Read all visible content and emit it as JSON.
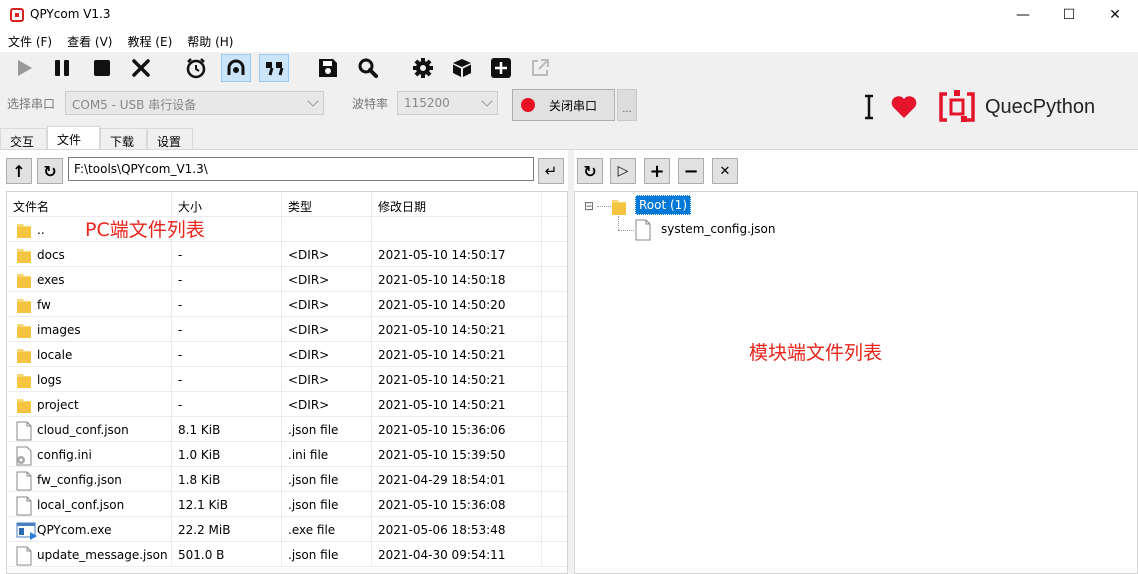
{
  "window": {
    "title": "QPYcom V1.3",
    "minimize_glyph": "—",
    "maximize_glyph": "☐",
    "close_glyph": "✕"
  },
  "menu": [
    "文件 (F)",
    "查看 (V)",
    "教程 (E)",
    "帮助 (H)"
  ],
  "toolbar": {
    "icons": [
      "play-icon",
      "pause-icon",
      "stop-icon",
      "clear-icon",
      "clock-icon",
      "hook-icon",
      "quote-icon",
      "save-icon",
      "search-icon",
      "gear-icon",
      "cube-icon",
      "plus-icon",
      "external-link-icon"
    ],
    "active": [
      "hook-icon",
      "quote-icon"
    ]
  },
  "serial": {
    "port_label": "选择串口",
    "port_value": "COM5 - USB 串行设备",
    "baud_label": "波特率",
    "baud_value": "115200",
    "close_button": "关闭串口",
    "more_button": "..."
  },
  "brand": {
    "name": "QuecPython",
    "accent": "#e5142a"
  },
  "tabs": [
    "交互",
    "文件",
    "下载",
    "设置"
  ],
  "active_tab": "文件",
  "pc_pane": {
    "path": "F:\\tools\\QPYcom_V1.3\\",
    "columns": [
      "文件名",
      "大小",
      "类型",
      "修改日期"
    ],
    "annotation": "PC端文件列表",
    "rows": [
      {
        "name": "..",
        "size": "",
        "type": "",
        "date": "",
        "kind": "folder"
      },
      {
        "name": "docs",
        "size": "-",
        "type": "<DIR>",
        "date": "2021-05-10 14:50:17",
        "kind": "folder"
      },
      {
        "name": "exes",
        "size": "-",
        "type": "<DIR>",
        "date": "2021-05-10 14:50:18",
        "kind": "folder"
      },
      {
        "name": "fw",
        "size": "-",
        "type": "<DIR>",
        "date": "2021-05-10 14:50:20",
        "kind": "folder"
      },
      {
        "name": "images",
        "size": "-",
        "type": "<DIR>",
        "date": "2021-05-10 14:50:21",
        "kind": "folder"
      },
      {
        "name": "locale",
        "size": "-",
        "type": "<DIR>",
        "date": "2021-05-10 14:50:21",
        "kind": "folder"
      },
      {
        "name": "logs",
        "size": "-",
        "type": "<DIR>",
        "date": "2021-05-10 14:50:21",
        "kind": "folder"
      },
      {
        "name": "project",
        "size": "-",
        "type": "<DIR>",
        "date": "2021-05-10 14:50:21",
        "kind": "folder"
      },
      {
        "name": "cloud_conf.json",
        "size": "8.1 KiB",
        "type": ".json file",
        "date": "2021-05-10 15:36:06",
        "kind": "file"
      },
      {
        "name": "config.ini",
        "size": "1.0 KiB",
        "type": ".ini file",
        "date": "2021-05-10 15:39:50",
        "kind": "ini"
      },
      {
        "name": "fw_config.json",
        "size": "1.8 KiB",
        "type": ".json file",
        "date": "2021-04-29 18:54:01",
        "kind": "file"
      },
      {
        "name": "local_conf.json",
        "size": "12.1 KiB",
        "type": ".json file",
        "date": "2021-05-10 15:36:08",
        "kind": "file"
      },
      {
        "name": "QPYcom.exe",
        "size": "22.2 MiB",
        "type": ".exe file",
        "date": "2021-05-06 18:53:48",
        "kind": "exe"
      },
      {
        "name": "update_message.json",
        "size": "501.0 B",
        "type": ".json file",
        "date": "2021-04-30 09:54:11",
        "kind": "file"
      }
    ]
  },
  "module_pane": {
    "root_label": "Root (1)",
    "files": [
      "system_config.json"
    ],
    "annotation": "模块端文件列表",
    "collapse_glyph": "⊟"
  },
  "nav_glyphs": {
    "up": "↑",
    "refresh": "↻",
    "enter": "↵",
    "run": "▷",
    "add": "+",
    "remove": "−",
    "delete": "✕"
  }
}
